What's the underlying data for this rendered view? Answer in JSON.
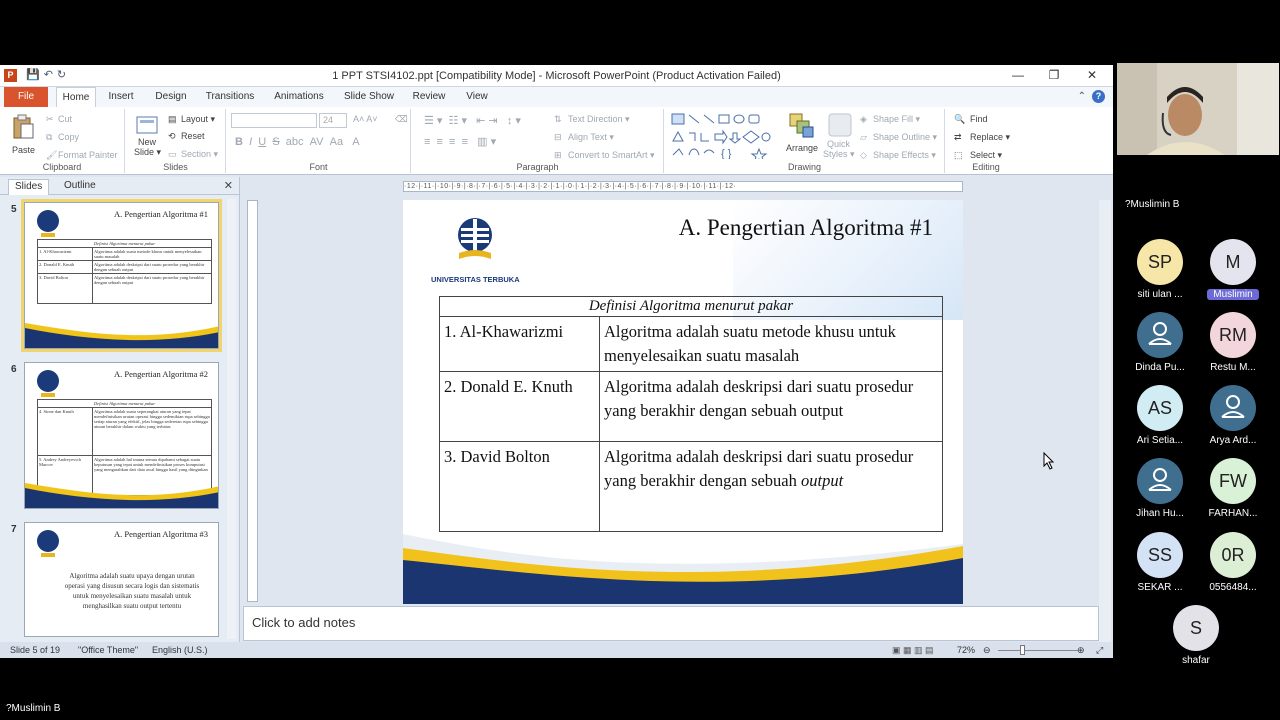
{
  "window": {
    "app_icon": "P",
    "title": "1 PPT  STSI4102.ppt [Compatibility Mode]  -  Microsoft PowerPoint (Product Activation Failed)"
  },
  "tabs": [
    "File",
    "Home",
    "Insert",
    "Design",
    "Transitions",
    "Animations",
    "Slide Show",
    "Review",
    "View"
  ],
  "ribbon": {
    "clipboard": {
      "paste": "Paste",
      "cut": "Cut",
      "copy": "Copy",
      "format_painter": "Format Painter",
      "label": "Clipboard"
    },
    "slides": {
      "new_slide_1": "New",
      "new_slide_2": "Slide ▾",
      "layout": "Layout ▾",
      "reset": "Reset",
      "section": "Section ▾",
      "label": "Slides"
    },
    "font": {
      "size": "24",
      "label": "Font"
    },
    "paragraph": {
      "text_direction": "Text Direction ▾",
      "align_text": "Align Text ▾",
      "convert_smartart": "Convert to SmartArt ▾",
      "label": "Paragraph"
    },
    "drawing": {
      "arrange": "Arrange",
      "quick_1": "Quick",
      "quick_2": "Styles ▾",
      "shape_fill": "Shape Fill ▾",
      "shape_outline": "Shape Outline ▾",
      "shape_effects": "Shape Effects ▾",
      "label": "Drawing"
    },
    "editing": {
      "find": "Find",
      "replace": "Replace ▾",
      "select": "Select ▾",
      "label": "Editing"
    }
  },
  "panel": {
    "tab_slides": "Slides",
    "tab_outline": "Outline",
    "close": "✕"
  },
  "thumbnails": [
    {
      "num": "5",
      "title": "A. Pengertian Algoritma #1",
      "header": "Definisi Algoritma menurut pakar",
      "rows": [
        [
          "1. Al-Khawarizmi",
          "Algoritma adalah suatu metode khusu untuk menyelesaikan suatu masalah"
        ],
        [
          "2. Donald E. Knuth",
          "Algoritma adalah deskripsi dari suatu prosedur yang berakhir dengan sebuah output"
        ],
        [
          "3. David Bolton",
          "Algoritma adalah deskripsi dari suatu prosedur yang berakhir dengan sebuah output"
        ]
      ]
    },
    {
      "num": "6",
      "title": "A. Pengertian Algoritma #2",
      "header": "Definisi Algoritma menurut pakar",
      "rows": [
        [
          "4. Stone dan Knuth",
          "Algoritma adalah suatu seperangkat aturan yang tepat mendefinisikan urutan operasi hingga sedemikian rupa sehingga setiap aturan yang efektif, jelas hingga sederetan rupa sehingga aturan berakhir dalam waktu yang terbatas"
        ],
        [
          "5. Andrey Andreyevich Marcov",
          "Algoritma adalah hal imuna semua dipahami sebagai suatu keputusan yang tepat untuk mendefinisikan proses komputasi yang mengarahkan dari data awal hingga hasil yang diinginkan"
        ]
      ]
    },
    {
      "num": "7",
      "title": "A. Pengertian Algoritma #3",
      "body": "Algoritma adalah suatu upaya dengan urutan operasi yang disusun secara logis dan sistematis untuk menyelesaikan suatu masalah untuk menghasilkan suatu output tertentu"
    }
  ],
  "slide": {
    "title": "A. Pengertian Algoritma #1",
    "logo_text": "UNIVERSITAS TERBUKA",
    "table_header": "Definisi Algoritma menurut pakar",
    "rows": [
      {
        "name": "1. Al-Khawarizmi",
        "def": "Algoritma adalah suatu metode khusu untuk menyelesaikan suatu masalah"
      },
      {
        "name": "2. Donald E. Knuth",
        "def_1": "Algoritma adalah deskripsi dari suatu prosedur yang berakhir dengan sebuah",
        "def_2": "output"
      },
      {
        "name": "3. David Bolton",
        "def_1": "Algoritma adalah deskripsi dari suatu prosedur yang berakhir dengan sebuah",
        "def_2": "output"
      }
    ]
  },
  "ruler_text": "·12·|·11·|·10·|·9·|·8·|·7·|·6·|·5·|·4·|·3·|·2·|·1·|·0·|·1·|·2·|·3·|·4·|·5·|·6·|·7·|·8·|·9·|·10·|·11·|·12·",
  "notes_placeholder": "Click to add notes",
  "status": {
    "slide": "Slide 5 of 19",
    "theme": "\"Office Theme\"",
    "lang": "English (U.S.)",
    "zoom": "72%"
  },
  "meeting": {
    "speaker_name": "?Muslimin B",
    "bottom_name": "?Muslimin B",
    "participants": [
      {
        "initials": "SP",
        "name": "siti ulan ...",
        "color": "#f6e6a8"
      },
      {
        "initials": "M",
        "name": "Muslimin",
        "color": "#e4e4ee",
        "highlight": true
      },
      {
        "initials": "",
        "name": "Dinda Pu...",
        "color": "#3f6e8f",
        "icon": "person-icon"
      },
      {
        "initials": "RM",
        "name": "Restu M...",
        "color": "#f3d6dc"
      },
      {
        "initials": "AS",
        "name": "Ari Setia...",
        "color": "#d2ecf3"
      },
      {
        "initials": "",
        "name": "Arya Ard...",
        "color": "#3f6e8f",
        "icon": "person-icon"
      },
      {
        "initials": "",
        "name": "Jihan Hu...",
        "color": "#3f6e8f",
        "icon": "person-icon"
      },
      {
        "initials": "FW",
        "name": "FARHAN...",
        "color": "#d9f1d6"
      },
      {
        "initials": "SS",
        "name": "SEKAR ...",
        "color": "#d4e2f6"
      },
      {
        "initials": "0R",
        "name": "0556484...",
        "color": "#dcefd5"
      },
      {
        "initials": "S",
        "name": "shafar",
        "color": "#e2e2e8"
      }
    ]
  }
}
